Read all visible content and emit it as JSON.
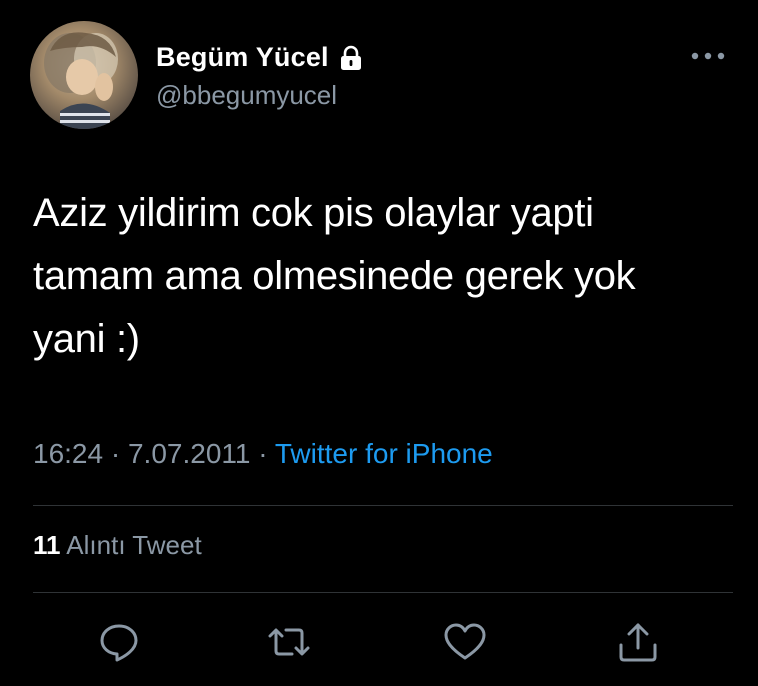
{
  "author": {
    "display_name": "Begüm Yücel",
    "handle": "@bbegumyucel",
    "protected": true
  },
  "tweet": {
    "text": "Aziz yildirim cok pis olaylar yapti\ntamam ama olmesinede gerek yok\nyani :)",
    "time": "16:24",
    "separator": "·",
    "date": "7.07.2011",
    "source": "Twitter for iPhone"
  },
  "stats": {
    "quote_count": "11",
    "quote_label": "Alıntı Tweet"
  },
  "actions": {
    "reply": "reply-icon",
    "retweet": "retweet-icon",
    "like": "heart-icon",
    "share": "share-icon"
  },
  "colors": {
    "background": "#000000",
    "text": "#ffffff",
    "secondary_text": "#8b98a5",
    "link": "#1d9bf0",
    "divider": "#2f3336"
  }
}
